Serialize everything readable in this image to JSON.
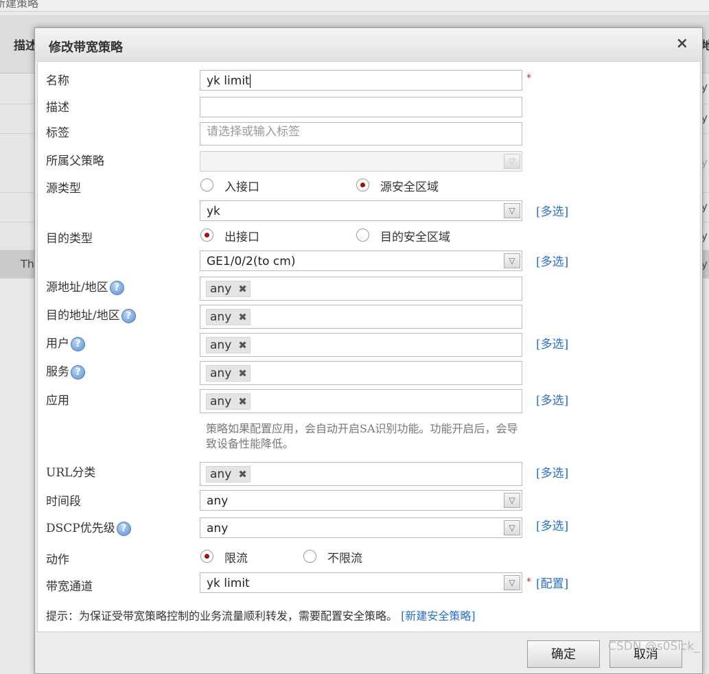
{
  "background": {
    "top_label": "新建策略",
    "header_left": "描述",
    "header_right": "地",
    "row_right_char": "y",
    "row_left_text": "Th"
  },
  "dialog": {
    "title": "修改带宽策略",
    "close_symbol": "×",
    "fields": {
      "name": {
        "label": "名称",
        "value": "yk limit"
      },
      "description": {
        "label": "描述",
        "value": ""
      },
      "tags": {
        "label": "标签",
        "placeholder": "请选择或输入标签"
      },
      "parent_policy": {
        "label": "所属父策略",
        "value": ""
      },
      "source_type": {
        "label": "源类型",
        "option_interface": "入接口",
        "option_zone": "源安全区域",
        "selected": "源安全区域",
        "select_value": "yk"
      },
      "dest_type": {
        "label": "目的类型",
        "option_interface": "出接口",
        "option_zone": "目的安全区域",
        "selected": "出接口",
        "select_value": "GE1/0/2(to cm)"
      },
      "source_address": {
        "label": "源地址/地区",
        "tag": "any"
      },
      "dest_address": {
        "label": "目的地址/地区",
        "tag": "any"
      },
      "user": {
        "label": "用户",
        "tag": "any"
      },
      "service": {
        "label": "服务",
        "tag": "any"
      },
      "application": {
        "label": "应用",
        "tag": "any"
      },
      "app_note": "策略如果配置应用，会自动开启SA识别功能。功能开启后，会导致设备性能降低。",
      "url_category": {
        "label": "URL分类",
        "tag": "any"
      },
      "time_range": {
        "label": "时间段",
        "value": "any"
      },
      "dscp": {
        "label": "DSCP优先级",
        "value": "any"
      },
      "action": {
        "label": "动作",
        "option_limit": "限流",
        "option_nolimit": "不限流",
        "selected": "限流"
      },
      "bandwidth_channel": {
        "label": "带宽通道",
        "value": "yk limit",
        "link": "[配置]"
      }
    },
    "multi_select_link": "[多选]",
    "required_mark": "*",
    "help_symbol": "?",
    "tag_remove": "✖",
    "dropdown_arrow": "▽",
    "tip_text": "提示：为保证受带宽策略控制的业务流量顺利转发，需要配置安全策略。",
    "tip_link": "[新建安全策略]",
    "ok_button": "确定",
    "cancel_button": "取消"
  },
  "watermark": "CSDN @s0Sick_",
  "colors": {
    "link": "#2a6fc9",
    "radio_selected": "#a30d0d",
    "required": "#d22222"
  }
}
